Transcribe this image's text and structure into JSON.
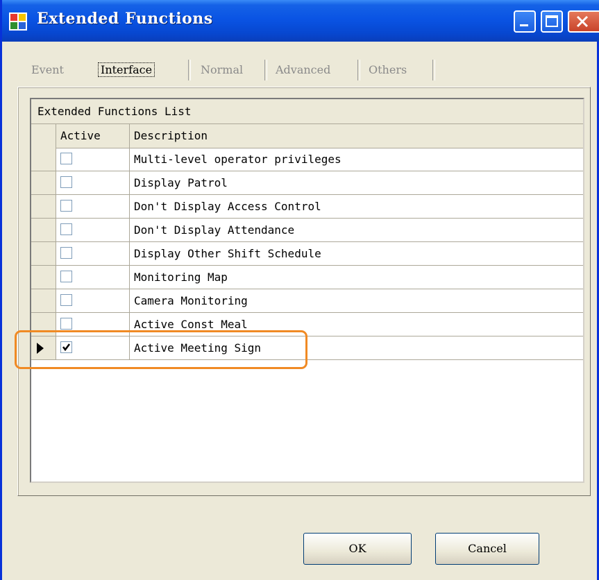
{
  "window": {
    "title": "Extended Functions"
  },
  "tabs": [
    {
      "label": "Event",
      "active": false
    },
    {
      "label": "Interface",
      "active": true
    },
    {
      "label": "Normal",
      "active": false
    },
    {
      "label": "Advanced",
      "active": false
    },
    {
      "label": "Others",
      "active": false
    }
  ],
  "grid": {
    "caption": "Extended Functions List",
    "columns": {
      "active": "Active",
      "description": "Description"
    },
    "rows": [
      {
        "description": "Multi-level operator privileges",
        "checked": false
      },
      {
        "description": "Display Patrol",
        "checked": false
      },
      {
        "description": "Don't Display Access Control",
        "checked": false
      },
      {
        "description": "Don't Display Attendance",
        "checked": false
      },
      {
        "description": "Display Other Shift Schedule",
        "checked": false
      },
      {
        "description": "Monitoring Map",
        "checked": false
      },
      {
        "description": "Camera Monitoring",
        "checked": false
      },
      {
        "description": "Active Const Meal",
        "checked": false
      },
      {
        "description": "Active Meeting Sign",
        "checked": true,
        "current": true
      }
    ]
  },
  "buttons": {
    "ok": "OK",
    "cancel": "Cancel"
  },
  "colors": {
    "highlight": "#F08A24",
    "titlebar": "#0A54E4",
    "dialog": "#ECE9D8"
  }
}
